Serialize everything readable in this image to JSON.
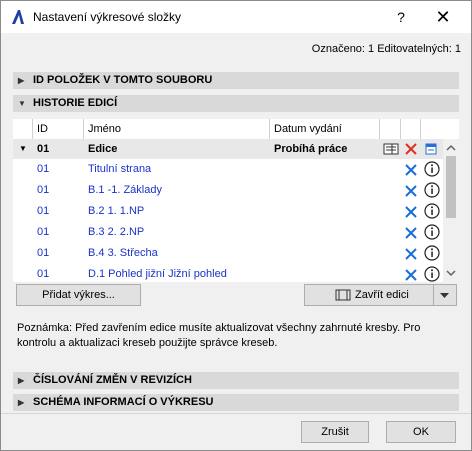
{
  "window": {
    "title": "Nastavení výkresové složky",
    "help": "?",
    "close": "✕"
  },
  "status": {
    "counter": "Označeno: 1 Editovatelných: 1"
  },
  "sections": {
    "ids": "ID POLOŽEK V TOMTO SOUBORU",
    "history": "HISTORIE EDICÍ",
    "numbering": "ČÍSLOVÁNÍ ZMĚN V REVIZÍCH",
    "schema": "SCHÉMA INFORMACÍ O VÝKRESU"
  },
  "table": {
    "headers": {
      "id": "ID",
      "name": "Jméno",
      "date": "Datum vydání"
    },
    "group": {
      "id": "01",
      "name": "Edice",
      "status": "Probíhá práce"
    },
    "rows": [
      {
        "id": "01",
        "name": "Titulní strana"
      },
      {
        "id": "01",
        "name": "B.1 -1. Základy"
      },
      {
        "id": "01",
        "name": "B.2 1. 1.NP"
      },
      {
        "id": "01",
        "name": "B.3 2. 2.NP"
      },
      {
        "id": "01",
        "name": "B.4 3. Střecha"
      },
      {
        "id": "01",
        "name": "D.1 Pohled jižní Jižní pohled"
      }
    ]
  },
  "buttons": {
    "add": "Přidat výkres...",
    "close_edition": "Zavřít edici",
    "cancel": "Zrušit",
    "ok": "OK"
  },
  "note": "Poznámka: Před zavřením edice musíte aktualizovat všechny zahrnuté kresby. Pro kontrolu a aktualizaci kreseb použijte správce kreseb.",
  "colors": {
    "accent": "#1a33c8",
    "delete": "#e0301e",
    "header": "#d9d9d9"
  }
}
